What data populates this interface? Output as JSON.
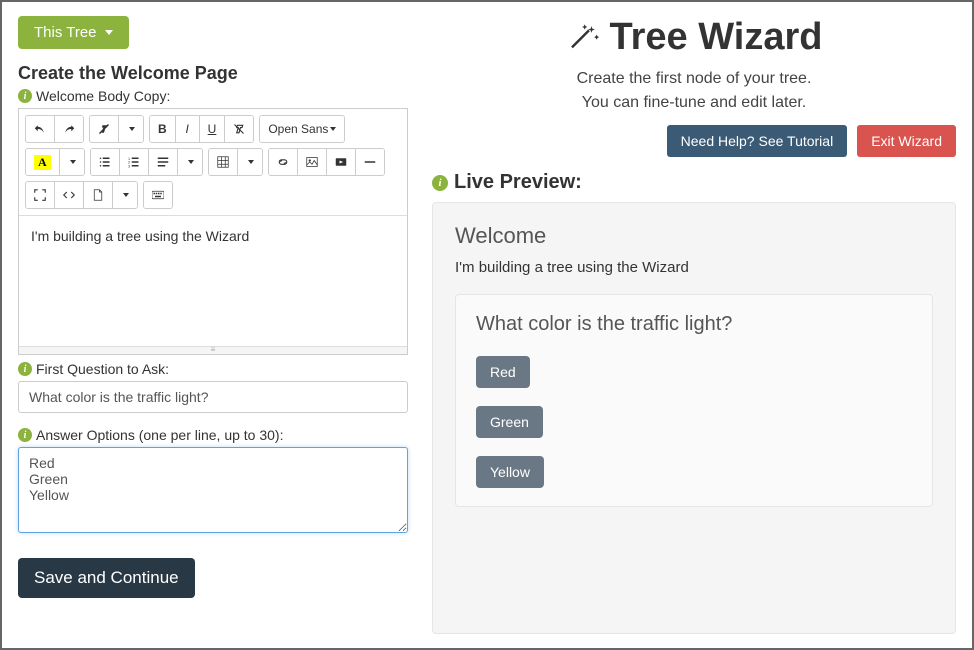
{
  "header": {
    "this_tree_label": "This Tree",
    "page_title": "Tree Wizard",
    "subtitle_line1": "Create the first node of your tree.",
    "subtitle_line2": "You can fine-tune and edit later.",
    "help_label": "Need Help? See Tutorial",
    "exit_label": "Exit Wizard"
  },
  "left": {
    "section_title": "Create the Welcome Page",
    "welcome_body_label": "Welcome Body Copy:",
    "font_name": "Open Sans",
    "color_letter": "A",
    "editor_text": "I'm building a tree using the Wizard",
    "first_question_label": "First Question to Ask:",
    "first_question_value": "What color is the traffic light?",
    "answer_options_label": "Answer Options (one per line, up to 30):",
    "answer_options_value": "Red\nGreen\nYellow",
    "save_label": "Save and Continue"
  },
  "preview": {
    "heading": "Live Preview:",
    "welcome_title": "Welcome",
    "welcome_body": "I'm building a tree using the Wizard",
    "question": "What color is the traffic light?",
    "answers": [
      "Red",
      "Green",
      "Yellow"
    ]
  }
}
